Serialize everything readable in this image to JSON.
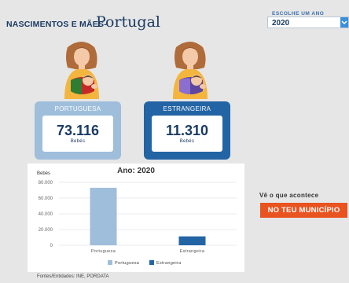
{
  "header": {
    "title": "NASCIMENTOS E MÃES-",
    "country": "Portugal"
  },
  "year_picker": {
    "label": "Escolhe um ano",
    "value": "2020"
  },
  "cards": [
    {
      "label": "PORTUGUESA",
      "value": "73.116",
      "unit": "Bebés",
      "color": "#9fbedb"
    },
    {
      "label": "ESTRANGEIRA",
      "value": "11.310",
      "unit": "Bebés",
      "color": "#2364a5"
    }
  ],
  "chart_data": {
    "type": "bar",
    "title": "Ano: 2020",
    "ylabel": "Bebés",
    "xlabel": "",
    "categories": [
      "Portuguesa",
      "Estrangeira"
    ],
    "values": [
      73116,
      11310
    ],
    "colors": [
      "#9fbedb",
      "#2364a5"
    ],
    "ylim": [
      0,
      80000
    ],
    "yticks": [
      "0",
      "20.000",
      "40.000",
      "60.000",
      "80.000"
    ],
    "legend": [
      "Portuguesa",
      "Estrangeira"
    ],
    "legend_position": "bottom",
    "grid": true
  },
  "cta": {
    "prompt": "Vê o que acontece",
    "button": "NO TEU MUNICÍPIO"
  },
  "footer": {
    "sources": "Fontes/Entidades: INE, PORDATA"
  }
}
